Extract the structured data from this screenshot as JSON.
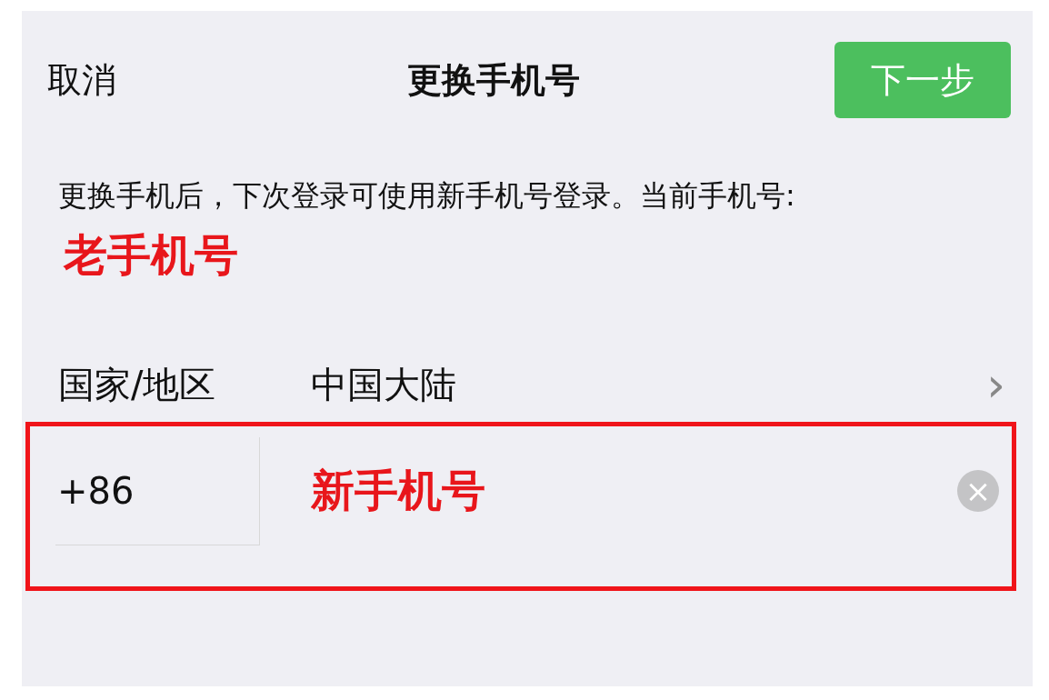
{
  "nav_bar": {
    "cancel": "取消",
    "title": "更换手机号",
    "next_button": "下一步"
  },
  "description": "更换手机后，下次登录可使用新手机号登录。当前手机号:",
  "current_number_note": "老手机号",
  "country_row": {
    "label": "国家/地区",
    "value": "中国大陆",
    "chevron": "›"
  },
  "phone_row": {
    "code": "+86",
    "value": "新手机号",
    "highlighted": true,
    "clear_button": "×"
  }
}
